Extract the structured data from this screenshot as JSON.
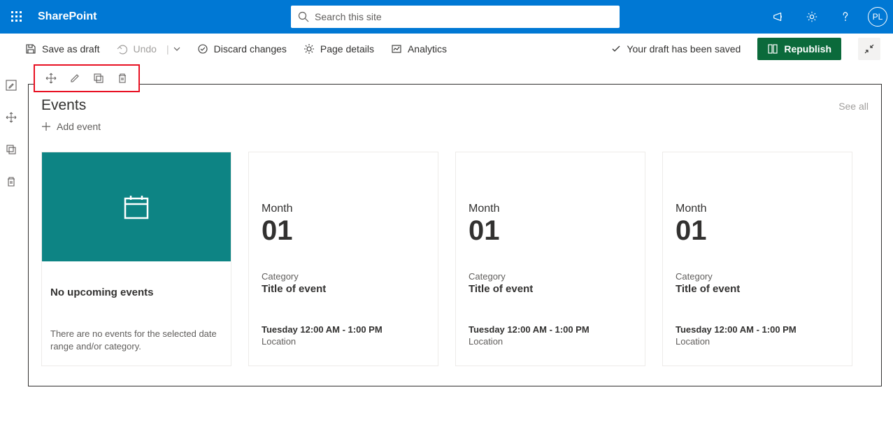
{
  "suite": {
    "app_name": "SharePoint",
    "search_placeholder": "Search this site",
    "avatar_initials": "PL"
  },
  "command_bar": {
    "save_as_draft": "Save as draft",
    "undo": "Undo",
    "discard_changes": "Discard changes",
    "page_details": "Page details",
    "analytics": "Analytics",
    "saved_status": "Your draft has been saved",
    "republish": "Republish"
  },
  "webpart": {
    "title": "Events",
    "see_all": "See all",
    "add_event": "Add event",
    "empty_card": {
      "title": "No upcoming events",
      "description": "There are no events for the selected date range and/or category."
    },
    "sample_cards": [
      {
        "month": "Month",
        "day": "01",
        "category": "Category",
        "title": "Title of event",
        "time": "Tuesday 12:00 AM - 1:00 PM",
        "location": "Location"
      },
      {
        "month": "Month",
        "day": "01",
        "category": "Category",
        "title": "Title of event",
        "time": "Tuesday 12:00 AM - 1:00 PM",
        "location": "Location"
      },
      {
        "month": "Month",
        "day": "01",
        "category": "Category",
        "title": "Title of event",
        "time": "Tuesday 12:00 AM - 1:00 PM",
        "location": "Location"
      }
    ]
  }
}
